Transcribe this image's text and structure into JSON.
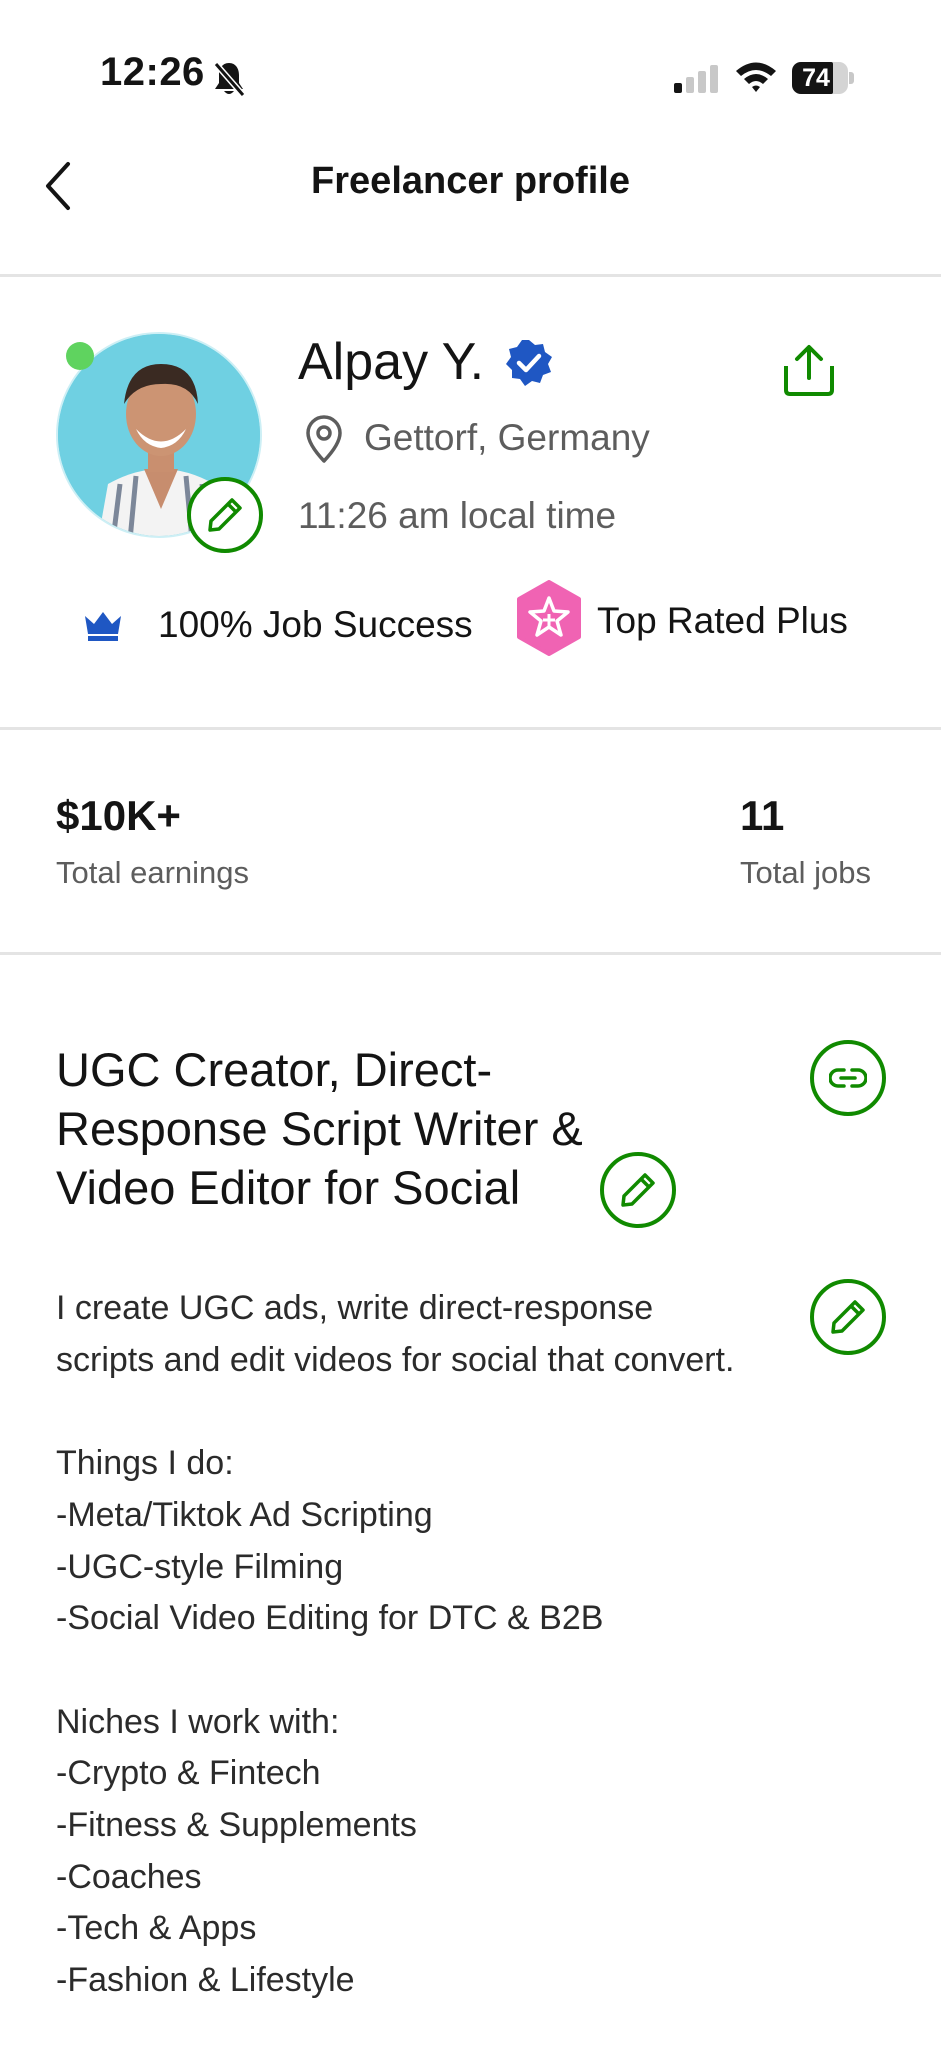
{
  "status_bar": {
    "time": "12:26",
    "battery": "74"
  },
  "nav": {
    "title": "Freelancer profile"
  },
  "profile": {
    "name": "Alpay Y.",
    "location": "Gettorf, Germany",
    "local_time": "11:26 am local time",
    "job_success": "100% Job Success",
    "top_rated": "Top Rated Plus"
  },
  "stats": {
    "earnings_value": "$10K+",
    "earnings_label": "Total earnings",
    "jobs_value": "11",
    "jobs_label": "Total jobs"
  },
  "headline": "UGC Creator, Direct-Response Script Writer & Video Editor for Social",
  "overview": "I create UGC ads, write direct-response scripts and edit videos for social that convert.\n\nThings I do:\n-Meta/Tiktok Ad Scripting\n-UGC-style Filming\n-Social Video Editing for DTC & B2B\n\nNiches I work with:\n-Crypto & Fintech\n-Fitness & Supplements\n-Coaches\n-Tech & Apps\n-Fashion & Lifestyle",
  "colors": {
    "accent_green": "#108a00",
    "verified_blue": "#1f57c3",
    "online_green": "#5fd35f",
    "top_rated_pink": "#f063b3"
  },
  "icons": [
    "muted-bell-icon",
    "signal-icon",
    "wifi-icon",
    "battery-icon",
    "back-chevron-icon",
    "verified-badge-icon",
    "share-icon",
    "location-pin-icon",
    "edit-pencil-icon",
    "crown-icon",
    "top-rated-plus-icon",
    "link-icon"
  ]
}
